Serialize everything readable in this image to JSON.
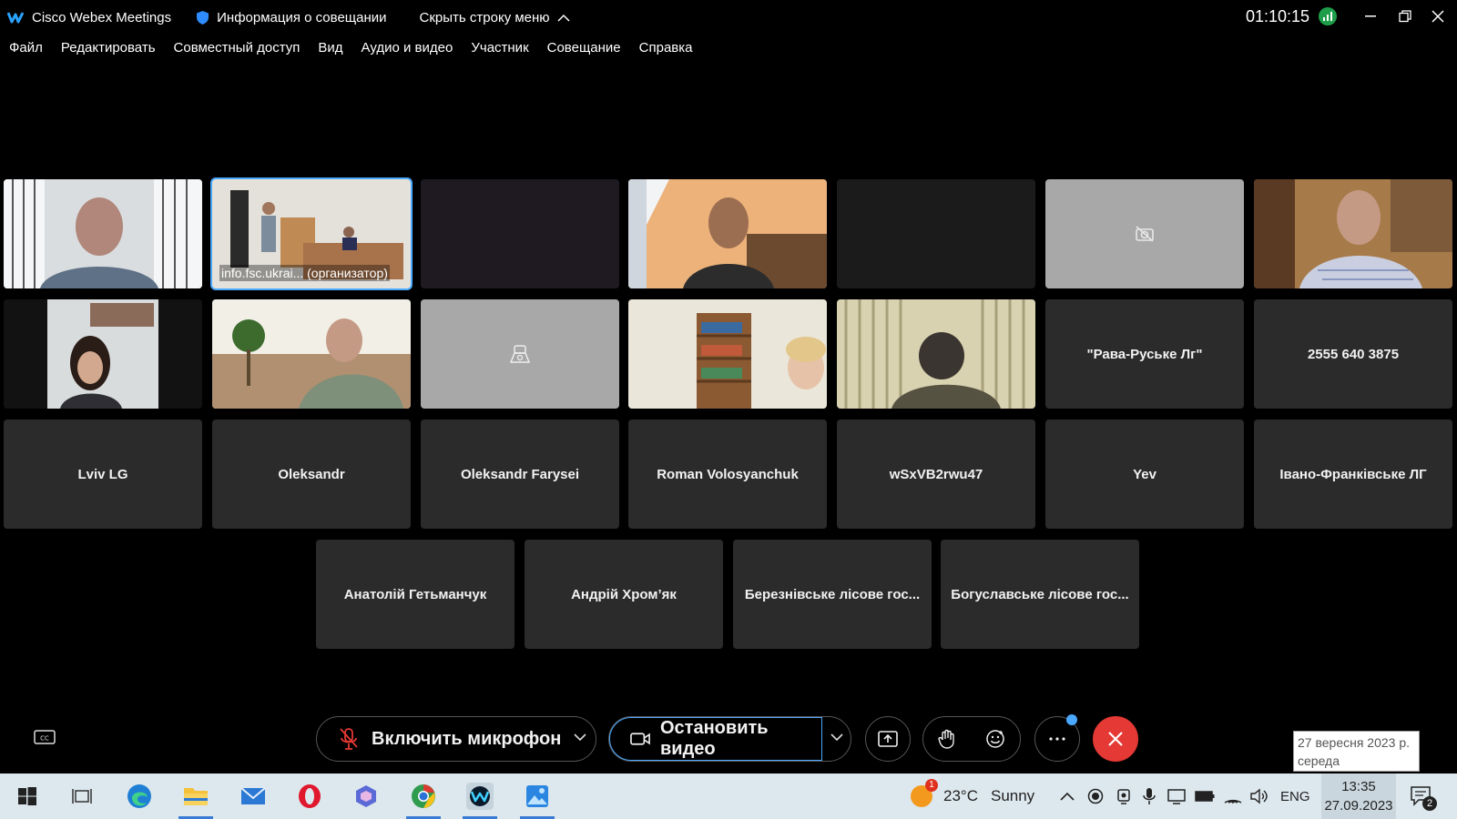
{
  "title_bar": {
    "app_name": "Cisco Webex Meetings",
    "meeting_info": "Информация о совещании",
    "hide_menu": "Скрыть строку меню",
    "timer": "01:10:15"
  },
  "menu": [
    "Файл",
    "Редактировать",
    "Совместный доступ",
    "Вид",
    "Аудио и видео",
    "Участник",
    "Совещание",
    "Справка"
  ],
  "grid": {
    "host_caption": "info.fsc.ukrai... (организатор)",
    "name_tiles": [
      "\"Рава-Руське Лг\"",
      "2555 640 3875",
      "Lviv LG",
      "Oleksandr",
      "Oleksandr Farysei",
      "Roman Volosyanchuk",
      "wSxVB2rwu47",
      "Yev",
      "Івано-Франківське ЛГ",
      "Анатолій Гетьманчук",
      "Андрій Хром’як",
      "Березнівське лісове гос...",
      "Богуславське лісове гос..."
    ]
  },
  "controls": {
    "mic_label": "Включить микрофон",
    "video_label": "Остановить видео",
    "end_color": "#e53935",
    "accent": "#4aa8ff"
  },
  "tooltip": {
    "line1": "27 вересня 2023 р.",
    "line2": "середа"
  },
  "taskbar": {
    "weather_temp": "23°C",
    "weather_desc": "Sunny",
    "weather_badge": "1",
    "language": "ENG",
    "time": "13:35",
    "date": "27.09.2023",
    "notif_count": "2"
  }
}
